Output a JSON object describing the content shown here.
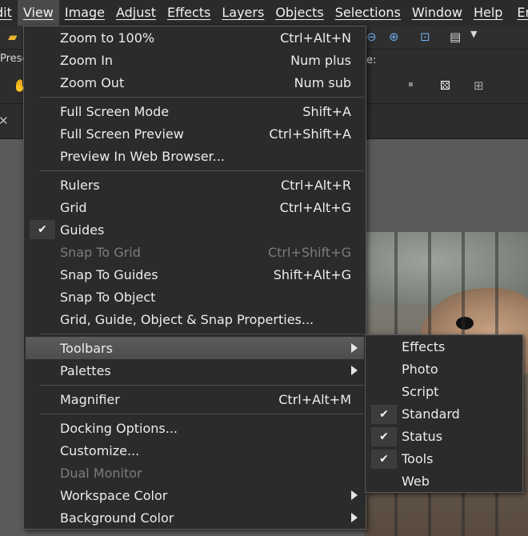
{
  "menubar": {
    "items": [
      "dit",
      "View",
      "Image",
      "Adjust",
      "Effects",
      "Layers",
      "Objects",
      "Selections",
      "Window",
      "Help",
      "Enh"
    ]
  },
  "toolbar": {
    "preset_label": "Prese",
    "e_label": "e:"
  },
  "view_menu": {
    "items": [
      {
        "label": "Zoom to 100%",
        "shortcut": "Ctrl+Alt+N"
      },
      {
        "label": "Zoom In",
        "shortcut": "Num plus"
      },
      {
        "label": "Zoom Out",
        "shortcut": "Num sub"
      },
      {
        "label": "Full Screen Mode",
        "shortcut": "Shift+A"
      },
      {
        "label": "Full Screen Preview",
        "shortcut": "Ctrl+Shift+A"
      },
      {
        "label": "Preview In Web Browser...",
        "shortcut": ""
      },
      {
        "label": "Rulers",
        "shortcut": "Ctrl+Alt+R"
      },
      {
        "label": "Grid",
        "shortcut": "Ctrl+Alt+G"
      },
      {
        "label": "Guides",
        "shortcut": "",
        "checked": true
      },
      {
        "label": "Snap To Grid",
        "shortcut": "Ctrl+Shift+G",
        "disabled": true
      },
      {
        "label": "Snap To Guides",
        "shortcut": "Shift+Alt+G"
      },
      {
        "label": "Snap To Object",
        "shortcut": ""
      },
      {
        "label": "Grid, Guide, Object & Snap Properties...",
        "shortcut": ""
      },
      {
        "label": "Toolbars",
        "submenu": true,
        "highlighted": true
      },
      {
        "label": "Palettes",
        "submenu": true
      },
      {
        "label": "Magnifier",
        "shortcut": "Ctrl+Alt+M"
      },
      {
        "label": "Docking Options...",
        "shortcut": ""
      },
      {
        "label": "Customize...",
        "shortcut": ""
      },
      {
        "label": "Dual Monitor",
        "shortcut": "",
        "disabled": true
      },
      {
        "label": "Workspace Color",
        "submenu": true
      },
      {
        "label": "Background Color",
        "submenu": true
      }
    ]
  },
  "toolbars_submenu": {
    "items": [
      {
        "label": "Effects",
        "checked": false
      },
      {
        "label": "Photo",
        "checked": false
      },
      {
        "label": "Script",
        "checked": false
      },
      {
        "label": "Standard",
        "checked": true
      },
      {
        "label": "Status",
        "checked": true
      },
      {
        "label": "Tools",
        "checked": true
      },
      {
        "label": "Web",
        "checked": false
      }
    ]
  },
  "check_glyph": "✔",
  "icons": [
    "open-folder-icon",
    "zoom-out-icon",
    "zoom-in-icon",
    "zoom-fit-icon",
    "paste-icon",
    "hand-pan-icon",
    "dice-icon",
    "grid-icon"
  ]
}
